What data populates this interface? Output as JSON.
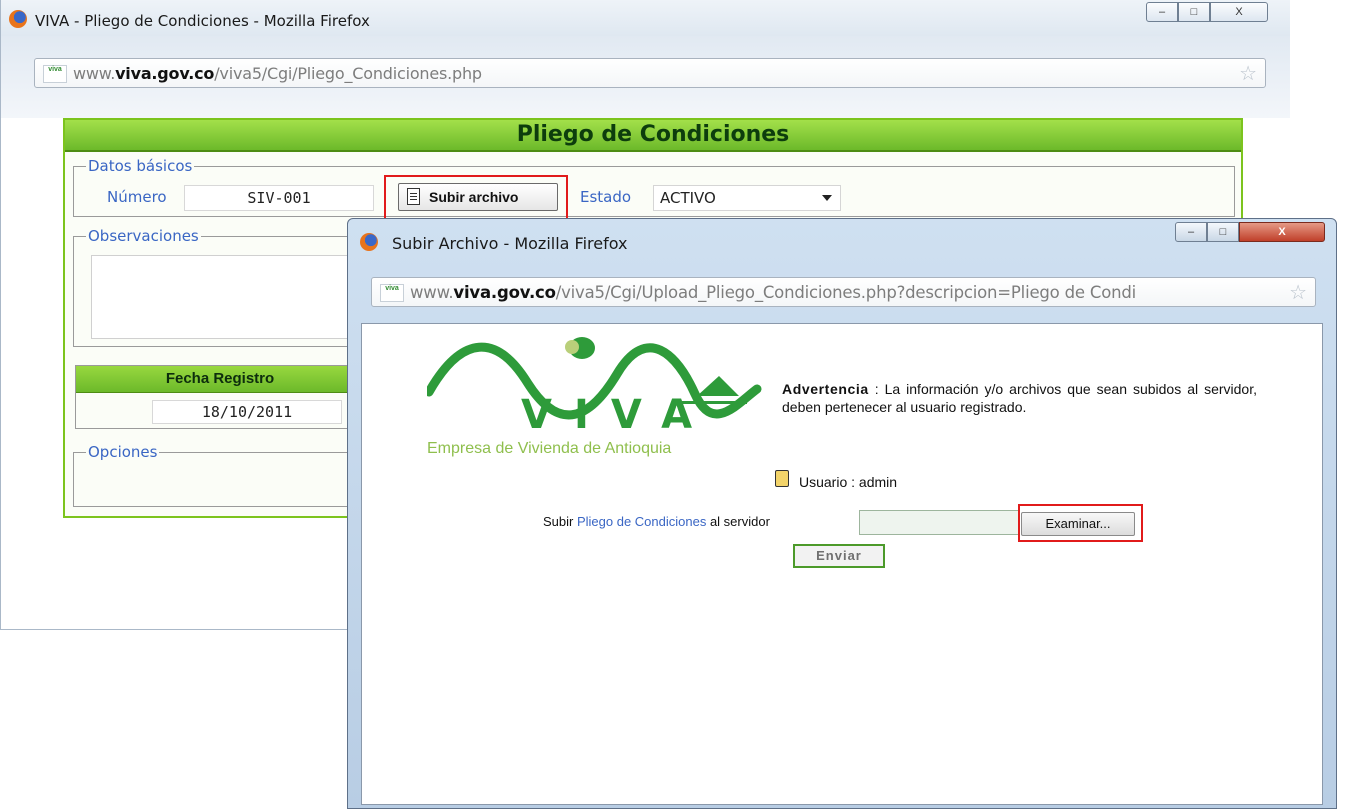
{
  "main_window": {
    "title": "VIVA - Pliego de Condiciones - Mozilla Firefox",
    "controls": {
      "minimize": "–",
      "maximize": "□",
      "close": "X"
    },
    "url": {
      "pre": "www.",
      "domain": "viva.gov.co",
      "post": "/viva5/Cgi/Pliego_Condiciones.php"
    },
    "site_icon": "viva",
    "form": {
      "header": "Pliego de Condiciones",
      "datos_basicos": {
        "legend": "Datos básicos",
        "numero_label": "Número",
        "numero_value": "SIV-001",
        "subir_button": "Subir archivo",
        "estado_label": "Estado",
        "estado_value": "ACTIVO"
      },
      "observaciones_legend": "Observaciones",
      "fecha_registro_label": "Fecha Registro",
      "fecha_registro_value": "18/10/2011",
      "opciones_legend": "Opciones"
    }
  },
  "popup_window": {
    "title": "Subir Archivo - Mozilla Firefox",
    "url": {
      "pre": "www.",
      "domain": "viva.gov.co",
      "post": "/viva5/Cgi/Upload_Pliego_Condiciones.php?descripcion=Pliego de Condi"
    },
    "site_icon": "viva",
    "logo": {
      "text": "VIVA",
      "subtitle": "Empresa de Vivienda de Antioquia"
    },
    "warning": {
      "label": "Advertencia",
      "text": " : La información y/o archivos que sean subidos al servidor, deben pertenecer al usuario registrado."
    },
    "user_text": "Usuario : admin",
    "upload": {
      "prefix": "Subir ",
      "link": "Pliego de Condiciones",
      "suffix": " al servidor",
      "browse_button": "Examinar...",
      "send_button": "Enviar"
    }
  },
  "colors": {
    "accent_green": "#7cc41d",
    "link_blue": "#3a66c4",
    "highlight_red": "#e11b1b",
    "logo_green": "#2e9b3a"
  }
}
